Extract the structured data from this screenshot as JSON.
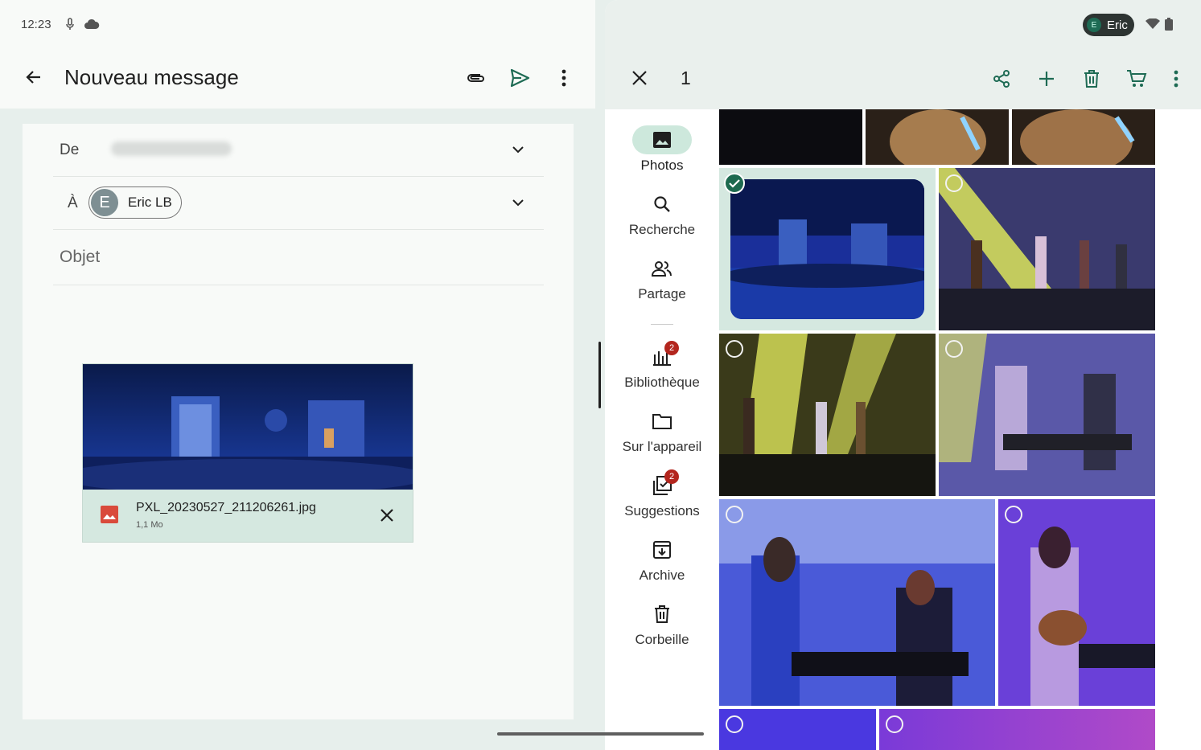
{
  "status": {
    "time": "12:23"
  },
  "mail": {
    "title": "Nouveau message",
    "from_label": "De",
    "to_label": "À",
    "recipient": {
      "initial": "E",
      "name": "Eric LB"
    },
    "subject_placeholder": "Objet",
    "attachment": {
      "filename": "PXL_20230527_211206261.jpg",
      "size": "1,1 Mo"
    }
  },
  "photos": {
    "account": {
      "initial": "E",
      "name": "Eric"
    },
    "selected_count": "1",
    "nav": [
      {
        "label": "Photos",
        "badge": ""
      },
      {
        "label": "Recherche",
        "badge": ""
      },
      {
        "label": "Partage",
        "badge": ""
      },
      {
        "label": "Bibliothèque",
        "badge": "2"
      },
      {
        "label": "Sur l'appareil",
        "badge": ""
      },
      {
        "label": "Suggestions",
        "badge": "2"
      },
      {
        "label": "Archive",
        "badge": ""
      },
      {
        "label": "Corbeille",
        "badge": ""
      }
    ]
  },
  "colors": {
    "accent_green": "#1d6a4f",
    "selection_bg": "#d5e8e0",
    "badge_red": "#b3261e",
    "send_green": "#1e6b54"
  },
  "icons": [
    "back-arrow-icon",
    "paperclip-icon",
    "send-icon",
    "more-vert-icon",
    "chevron-down-icon",
    "image-icon",
    "close-icon",
    "share-icon",
    "add-icon",
    "trash-icon",
    "cart-icon",
    "search-icon",
    "people-icon",
    "library-icon",
    "folder-icon",
    "suggestions-icon",
    "archive-icon",
    "wifi-icon",
    "battery-icon",
    "cloud-icon"
  ]
}
